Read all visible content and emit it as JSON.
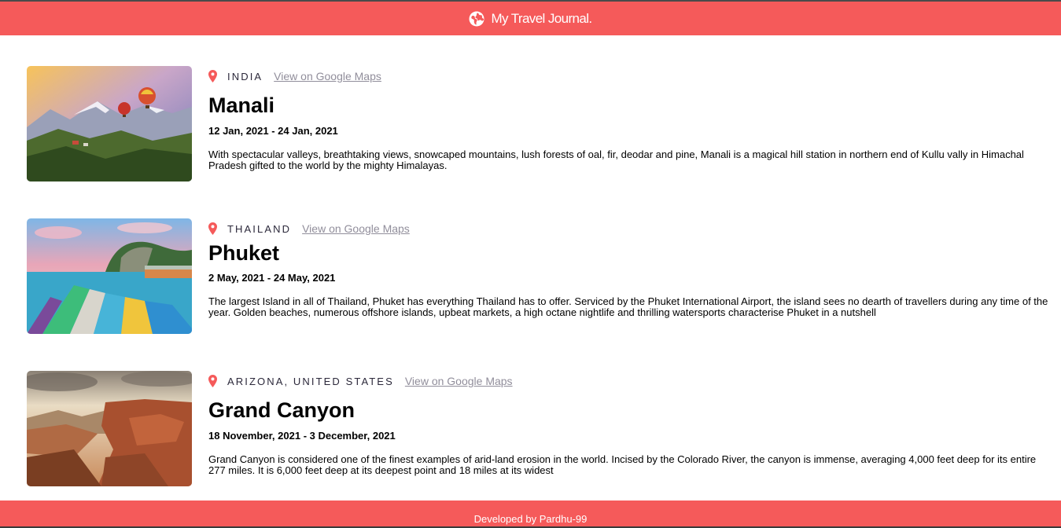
{
  "header": {
    "title": "My Travel Journal.",
    "icon": "globe-icon"
  },
  "colors": {
    "accent": "#f55a5a",
    "link": "#918e9b",
    "text": "#000000"
  },
  "entries": [
    {
      "country": "INDIA",
      "maps_label": "View on Google Maps",
      "title": "Manali",
      "dates": "12 Jan, 2021 - 24 Jan, 2021",
      "description": "With spectacular valleys, breathtaking views, snowcaped mountains, lush forests of oal, fir, deodar and pine, Manali is a magical hill station in northern end of Kullu vally in Himachal Pradesh gifted to the world by the mighty Himalayas."
    },
    {
      "country": "THAILAND",
      "maps_label": "View on Google Maps",
      "title": "Phuket",
      "dates": "2 May, 2021 - 24 May, 2021",
      "description": "The largest Island in all of Thailand, Phuket has everything Thailand has to offer. Serviced by the Phuket International Airport, the island sees no dearth of travellers during any time of the year. Golden beaches, numerous offshore islands, upbeat markets, a high octane nightlife and thrilling watersports characterise Phuket in a nutshell"
    },
    {
      "country": "ARIZONA, UNITED STATES",
      "maps_label": "View on Google Maps",
      "title": "Grand Canyon",
      "dates": "18 November, 2021 - 3 December, 2021",
      "description": "Grand Canyon is considered one of the finest examples of arid-land erosion in the world. Incised by the Colorado River, the canyon is immense, averaging 4,000 feet deep for its entire 277 miles. It is 6,000 feet deep at its deepest point and 18 miles at its widest"
    }
  ],
  "footer": {
    "text": "Developed by Pardhu-99"
  }
}
